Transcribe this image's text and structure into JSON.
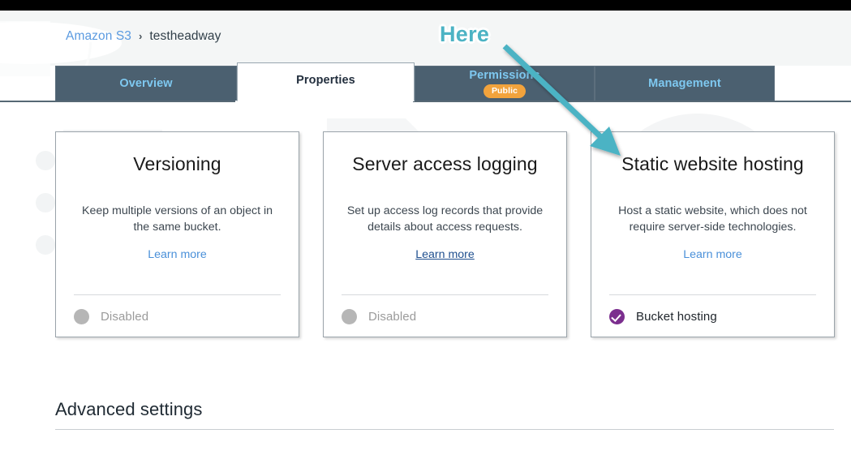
{
  "breadcrumb": {
    "root_label": "Amazon S3",
    "separator": "›",
    "current_label": "testheadway"
  },
  "tabs": [
    {
      "label": "Overview",
      "active": false
    },
    {
      "label": "Properties",
      "active": true
    },
    {
      "label": "Permissions",
      "active": false,
      "badge": "Public"
    },
    {
      "label": "Management",
      "active": false
    }
  ],
  "cards": [
    {
      "title": "Versioning",
      "description": "Keep multiple versions of an object in the same bucket.",
      "link_label": "Learn more",
      "status_label": "Disabled",
      "status_state": "disabled"
    },
    {
      "title": "Server access logging",
      "description": "Set up access log records that provide details about access requests.",
      "link_label": "Learn more",
      "status_label": "Disabled",
      "status_state": "disabled"
    },
    {
      "title": "Static website hosting",
      "description": "Host a static website, which does not require server-side technologies.",
      "link_label": "Learn more",
      "status_label": "Bucket hosting",
      "status_state": "enabled"
    }
  ],
  "sections": {
    "advanced_settings_title": "Advanced settings"
  },
  "annotation": {
    "here_label": "Here"
  },
  "colors": {
    "tab_bar": "#4b6070",
    "tab_label": "#7ec8f0",
    "active_tab_label": "#232f3e",
    "public_badge": "#f2a33c",
    "link": "#4a90d9",
    "enabled_status": "#7b2e8e",
    "disabled_status": "#b6b6b6",
    "annotation_teal": "#4cb3c4",
    "top_bar": "#000000"
  }
}
